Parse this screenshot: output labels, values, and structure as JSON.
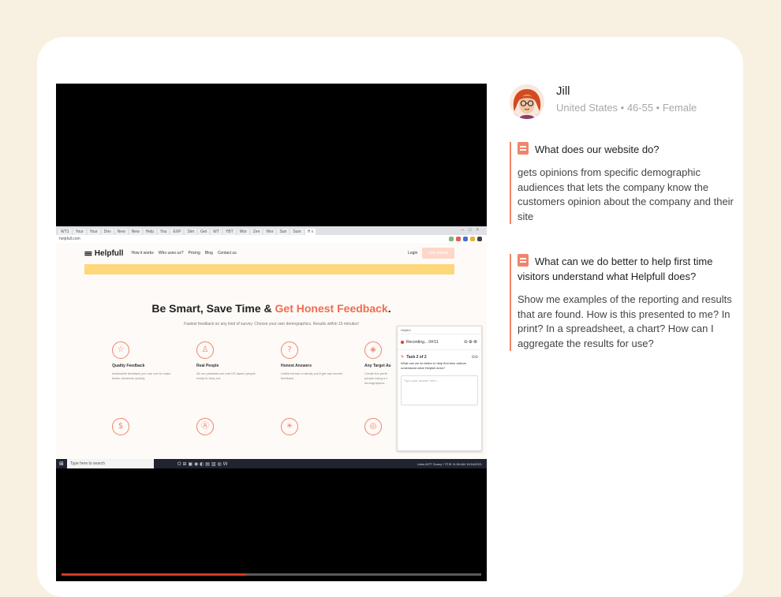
{
  "video": {
    "progress_fraction": 0.44,
    "browser_tabs": [
      "WT1",
      "Your",
      "Your",
      "Driv",
      "New",
      "New",
      "Help",
      "You",
      "EXP",
      "Sim",
      "Get",
      "WT",
      "YBT",
      "Wor",
      "Zen",
      "Wor",
      "Sun",
      "Sum",
      "H x"
    ],
    "address": "helpfull.com",
    "site": {
      "logo": "Helpfull",
      "nav": [
        "How it works",
        "Who uses us?",
        "Pricing",
        "Blog",
        "Contact us"
      ],
      "login": "Login",
      "cta": "Get started",
      "hero_title_main": "Be Smart, Save Time & ",
      "hero_title_accent": "Get Honest Feedback",
      "hero_title_end": ".",
      "hero_sub": "Fastest feedback on any kind of survey. Choose your own demographics. Results within 15 minutes!",
      "features": [
        {
          "icon": "☆",
          "title": "Quality Feedback",
          "desc": "Actionable feedback you can use to make better decisions quickly."
        },
        {
          "icon": "♙",
          "title": "Real People",
          "desc": "All our panelists are real US based people ready to help out."
        },
        {
          "icon": "?",
          "title": "Honest Answers",
          "desc": "Unlike friends or family you'll get raw honest feedback."
        },
        {
          "icon": "◈",
          "title": "Any Target Au",
          "desc": "Create the perfe people using a v demographics."
        }
      ],
      "row2_icons": [
        "$",
        "Ⓐ",
        "☀",
        "◎"
      ]
    },
    "popup": {
      "header": "Helpful",
      "recording": "Recording... 04:51",
      "controls": "⊖⊕⊗",
      "task": "Task 2 of 2",
      "task_ctl": "⊙⊙",
      "question": "What can we do better to help first time visitors understand what Helpfull does?",
      "answer_placeholder": "Type your answer here..."
    },
    "taskbar": {
      "search": "Type here to search",
      "icons": "O ⊞ ▣ ◉ ◐ ▤ ▥ ◍ W",
      "status": "Links   60°F Sunny ^  ⊡ ⊕ 11:56 AM 10/16/2021"
    }
  },
  "profile": {
    "name": "Jill",
    "meta": "United States • 46-55 • Female"
  },
  "qa": [
    {
      "question": "What does our website do?",
      "answer": "gets opinions from specific demographic audiences that lets the company know the customers opinion about the company and their site"
    },
    {
      "question": "What can we do better to help first time visitors understand what Helpfull does?",
      "answer": "Show me examples of the reporting and results that are found. How is this presented to me? In print? In a spreadsheet, a chart? How can I aggregate the results for use?"
    }
  ],
  "colors": {
    "page_bg": "#f8f1e2",
    "accent": "#f1846b",
    "progress": "#d23a2a"
  }
}
